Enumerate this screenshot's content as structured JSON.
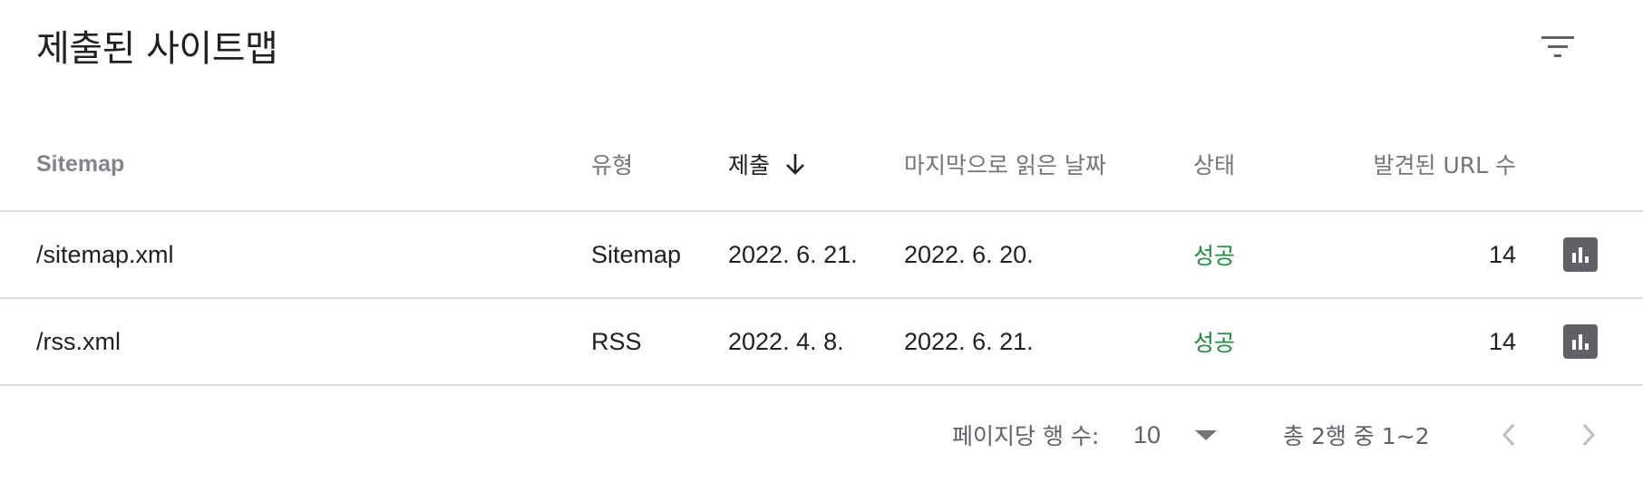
{
  "header": {
    "title": "제출된 사이트맵",
    "filter_icon": "filter-list-icon"
  },
  "table": {
    "columns": {
      "sitemap": "Sitemap",
      "type": "유형",
      "submitted": "제출",
      "last_read": "마지막으로 읽은 날짜",
      "status": "상태",
      "discovered_urls": "발견된 URL 수"
    },
    "sorted_column": "submitted",
    "sort_direction": "descending",
    "rows": [
      {
        "sitemap": "/sitemap.xml",
        "type": "Sitemap",
        "submitted": "2022. 6. 21.",
        "last_read": "2022. 6. 20.",
        "status": "성공",
        "discovered_urls": "14",
        "action_icon": "bar-chart-icon"
      },
      {
        "sitemap": "/rss.xml",
        "type": "RSS",
        "submitted": "2022. 4. 8.",
        "last_read": "2022. 6. 21.",
        "status": "성공",
        "discovered_urls": "14",
        "action_icon": "bar-chart-icon"
      }
    ]
  },
  "pagination": {
    "rows_per_page_label": "페이지당 행 수:",
    "rows_per_page_value": "10",
    "range_text": "총 2행 중 1~2",
    "prev_icon": "chevron-left-icon",
    "next_icon": "chevron-right-icon"
  },
  "colors": {
    "status_success": "#1e8e3e",
    "action_button": "#5f6368",
    "divider": "#e0e0e0"
  }
}
